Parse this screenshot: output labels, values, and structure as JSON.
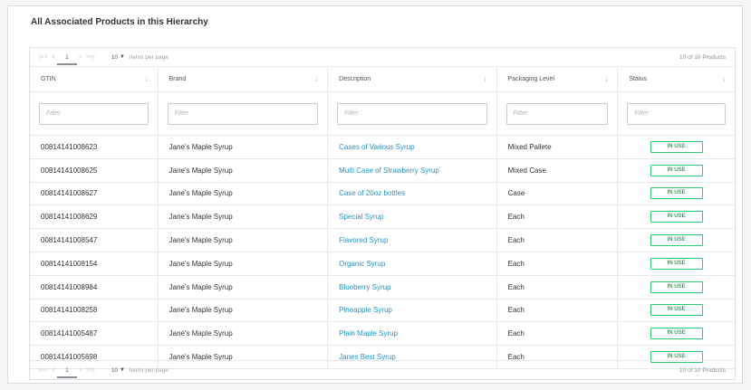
{
  "panel": {
    "title": "All Associated Products in this Hierarchy"
  },
  "pager": {
    "first": "|<<",
    "prev": "<",
    "next": ">",
    "last": ">>|",
    "page": "1",
    "page_size": "10",
    "page_size_label": "items per page",
    "total_top": "10 of 10 Products",
    "total_bottom": "10 of 10 Products"
  },
  "columns": [
    {
      "label": "GTIN",
      "placeholder": "Filter"
    },
    {
      "label": "Brand",
      "placeholder": "Filter"
    },
    {
      "label": "Description",
      "placeholder": "Filter"
    },
    {
      "label": "Packaging Level",
      "placeholder": "Filter"
    },
    {
      "label": "Status",
      "placeholder": "Filter"
    }
  ],
  "icons": {
    "sort": "sort-arrow-down-icon",
    "page_size_caret": "caret-down-icon"
  },
  "colors": {
    "link": "#2592c4",
    "status_border": "#2ecc71",
    "status_text": "#27ae60"
  },
  "rows": [
    {
      "gtin": "00814141008623",
      "brand": "Jane's Maple Syrup",
      "description": "Cases of Various Syrup",
      "packaging": "Mixed Pallete",
      "status": "IN USE"
    },
    {
      "gtin": "00814141008625",
      "brand": "Jane's Maple Syrup",
      "description": "Multi Case of Strawberry Syrup",
      "packaging": "Mixed Case",
      "status": "IN USE"
    },
    {
      "gtin": "00814141008627",
      "brand": "Jane's Maple Syrup",
      "description": "Case of 20oz bottles",
      "packaging": "Case",
      "status": "IN USE"
    },
    {
      "gtin": "00814141008629",
      "brand": "Jane's Maple Syrup",
      "description": "Special Syrup",
      "packaging": "Each",
      "status": "IN USE"
    },
    {
      "gtin": "00814141008547",
      "brand": "Jane's Maple Syrup",
      "description": "Flavored Syrup",
      "packaging": "Each",
      "status": "IN USE"
    },
    {
      "gtin": "00814141008154",
      "brand": "Jane's Maple Syrup",
      "description": "Organic Syrup",
      "packaging": "Each",
      "status": "IN USE"
    },
    {
      "gtin": "00814141008984",
      "brand": "Jane's Maple Syrup",
      "description": "Blueberry Syrup",
      "packaging": "Each",
      "status": "IN USE"
    },
    {
      "gtin": "00814141008258",
      "brand": "Jane's Maple Syrup",
      "description": "Pineapple Syrup",
      "packaging": "Each",
      "status": "IN USE"
    },
    {
      "gtin": "00814141005487",
      "brand": "Jane's Maple Syrup",
      "description": "Plain Maple Syrup",
      "packaging": "Each",
      "status": "IN USE"
    },
    {
      "gtin": "00814141005698",
      "brand": "Jane's Maple Syrup",
      "description": "Janes Best Syrup",
      "packaging": "Each",
      "status": "IN USE"
    }
  ]
}
